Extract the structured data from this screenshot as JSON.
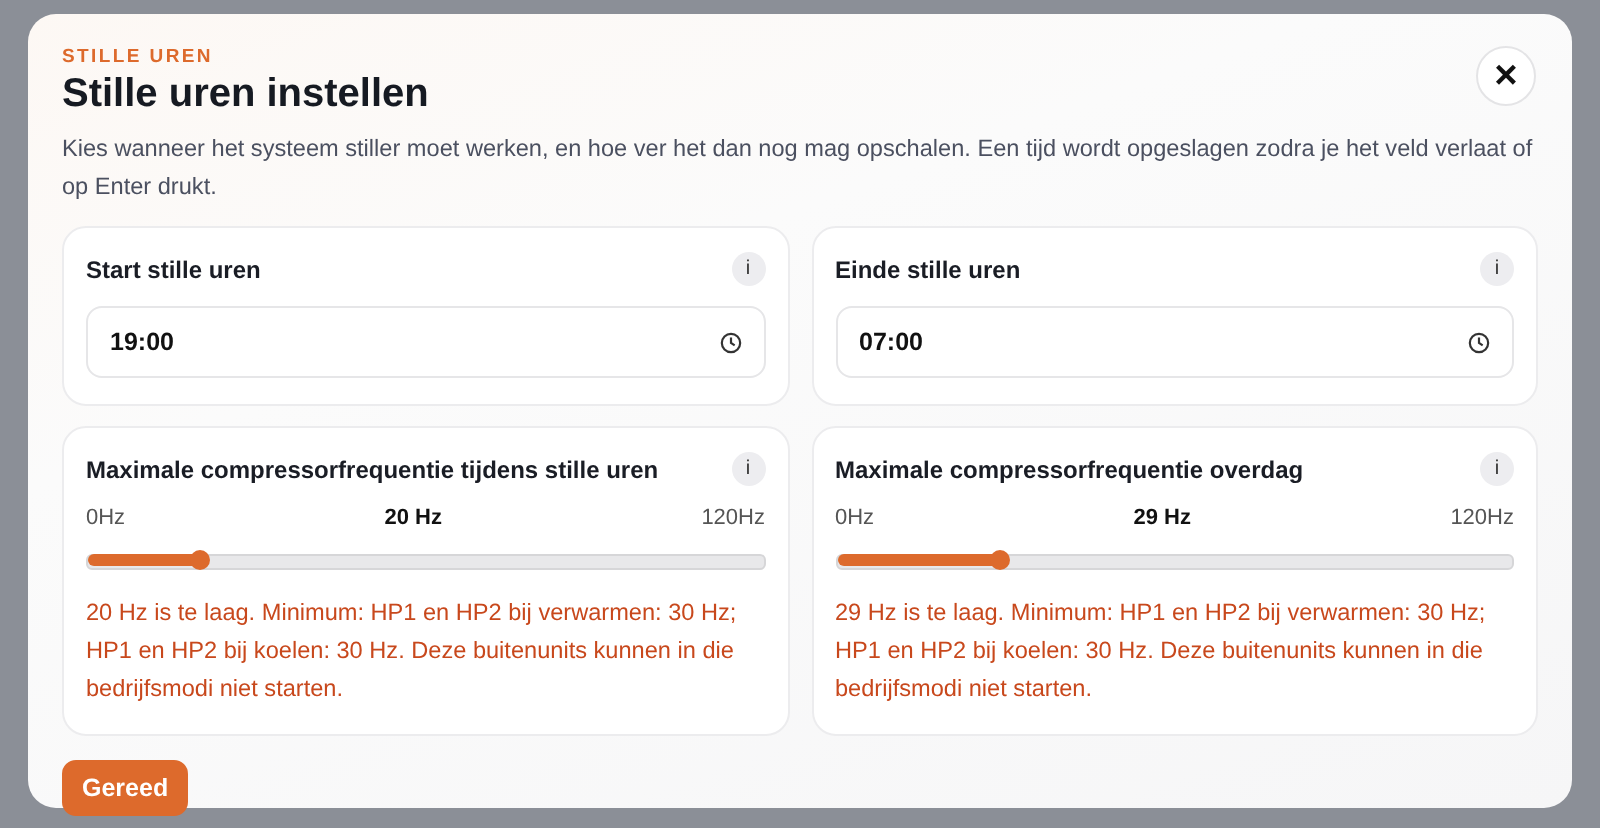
{
  "dialog": {
    "eyebrow": "STILLE UREN",
    "title": "Stille uren instellen",
    "description": "Kies wanneer het systeem stiller moet werken, en hoe ver het dan nog mag opschalen. Een tijd wordt opgeslagen zodra je het veld verlaat of op Enter drukt.",
    "close": "×"
  },
  "cards": [
    {
      "kind": "time",
      "title": "Start stille uren",
      "info": "i",
      "value": "19:00"
    },
    {
      "kind": "time",
      "title": "Einde stille uren",
      "info": "i",
      "value": "07:00"
    },
    {
      "kind": "slider",
      "title": "Maximale compressorfrequentie tijdens stille uren",
      "info": "i",
      "min": "0Hz",
      "reading": "20 Hz",
      "max": "120Hz",
      "level": 0.167,
      "error": "20 Hz is te laag. Minimum: HP1 en HP2 bij verwarmen: 30 Hz; HP1 en HP2 bij koelen: 30 Hz. Deze buitenunits kunnen in die bedrijfsmodi niet starten."
    },
    {
      "kind": "slider",
      "title": "Maximale compressorfrequentie overdag",
      "info": "i",
      "min": "0Hz",
      "reading": "29 Hz",
      "max": "120Hz",
      "level": 0.242,
      "error": "29 Hz is te laag. Minimum: HP1 en HP2 bij verwarmen: 30 Hz; HP1 en HP2 bij koelen: 30 Hz. Deze buitenunits kunnen in die bedrijfsmodi niet starten."
    }
  ],
  "done_button": "Gereed"
}
